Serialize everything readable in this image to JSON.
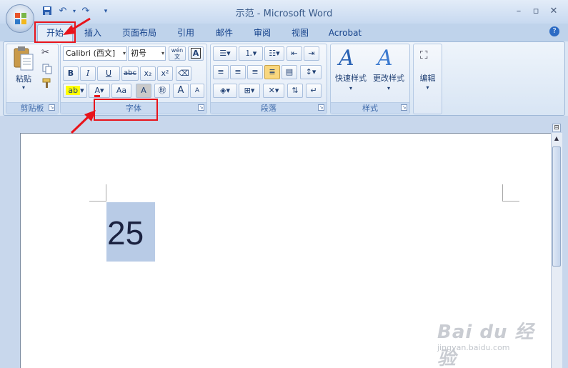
{
  "window": {
    "title": "示范 - Microsoft Word"
  },
  "quick_access": {
    "items": [
      "save-icon",
      "undo-icon",
      "redo-icon",
      "customize-icon"
    ]
  },
  "tabs": [
    {
      "label": "开始",
      "selected": true
    },
    {
      "label": "插入"
    },
    {
      "label": "页面布局"
    },
    {
      "label": "引用"
    },
    {
      "label": "邮件"
    },
    {
      "label": "审阅"
    },
    {
      "label": "视图"
    },
    {
      "label": "Acrobat"
    }
  ],
  "ribbon": {
    "clipboard": {
      "label": "剪贴板",
      "paste": "粘贴"
    },
    "font": {
      "label": "字体",
      "font_name": "Calibri (西文]",
      "font_size": "初号",
      "bold": "B",
      "italic": "I",
      "underline": "U",
      "strike": "abc",
      "subscript": "x₂",
      "superscript": "x²",
      "grow": "A",
      "shrink": "A",
      "case": "Aa",
      "wen": "wén 文",
      "A_boxed": "A"
    },
    "paragraph": {
      "label": "段落"
    },
    "styles": {
      "label": "样式",
      "quick_styles": "快速样式",
      "change_styles": "更改样式"
    },
    "editing": {
      "label": "编辑"
    }
  },
  "document": {
    "selected_text": "25"
  },
  "watermark": {
    "text": "Bai du 经验",
    "url": "jingyan.baidu.com"
  },
  "colors": {
    "highlight_red": "#e8141b",
    "selection": "#b8cbe6"
  }
}
